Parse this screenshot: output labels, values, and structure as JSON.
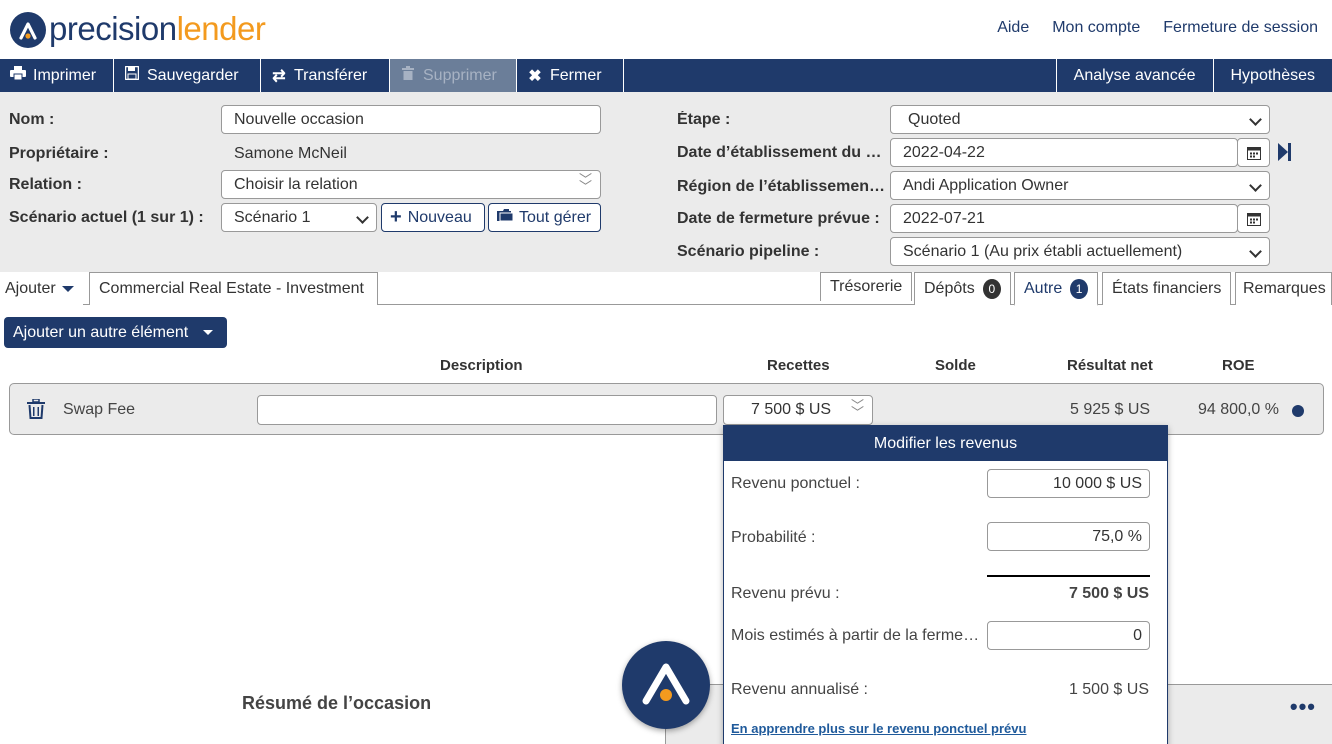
{
  "header": {
    "logo_part1": "precision",
    "logo_part2": "lender",
    "links": [
      "Aide",
      "Mon compte",
      "Fermeture de session"
    ]
  },
  "toolbar": {
    "print": "Imprimer",
    "save": "Sauvegarder",
    "transfer": "Transférer",
    "delete": "Supprimer",
    "close": "Fermer",
    "advanced": "Analyse avancée",
    "hypotheses": "Hypothèses"
  },
  "form": {
    "name_label": "Nom :",
    "name_value": "Nouvelle occasion",
    "owner_label": "Propriétaire :",
    "owner_value": "Samone McNeil",
    "relation_label": "Relation :",
    "relation_value": "Choisir la relation",
    "scenario_label": "Scénario actuel (1 sur 1) :",
    "scenario_value": "Scénario 1",
    "new_button": "Nouveau",
    "manage_button": "Tout gérer",
    "stage_label": "Étape :",
    "stage_value": "Quoted",
    "date_label": "Date d’établissement du …",
    "date_value": "2022-04-22",
    "region_label": "Région de l’établissemen…",
    "region_value": "Andi Application Owner",
    "close_date_label": "Date de fermeture prévue :",
    "close_date_value": "2022-07-21",
    "pipeline_label": "Scénario pipeline :",
    "pipeline_value": "Scénario 1 (Au prix établi actuellement)"
  },
  "tabs": {
    "add": "Ajouter",
    "product": "Commercial Real Estate - Investment",
    "treasury": "Trésorerie",
    "deposits": "Dépôts",
    "deposits_count": "0",
    "other": "Autre",
    "other_count": "1",
    "financials": "États financiers",
    "notes": "Remarques"
  },
  "other_section": {
    "add_button": "Ajouter un autre élément",
    "columns": [
      "Description",
      "Recettes",
      "Solde",
      "Résultat net",
      "ROE"
    ],
    "row": {
      "name": "Swap Fee",
      "description": "",
      "revenue": "7 500 $ US",
      "net_result": "5 925 $ US",
      "roe": "94 800,0 %"
    }
  },
  "popup": {
    "title": "Modifier les revenus",
    "one_time_label": "Revenu ponctuel :",
    "one_time_value": "10 000 $ US",
    "probability_label": "Probabilité :",
    "probability_value": "75,0 %",
    "expected_label": "Revenu prévu :",
    "expected_value": "7 500 $ US",
    "months_label": "Mois estimés à partir de la ferme…",
    "months_value": "0",
    "annualized_label": "Revenu annualisé :",
    "annualized_value": "1 500 $ US",
    "link": "En apprendre plus sur le revenu ponctuel prévu"
  },
  "summary": {
    "title": "Résumé de l’occasion",
    "more": "•••"
  }
}
